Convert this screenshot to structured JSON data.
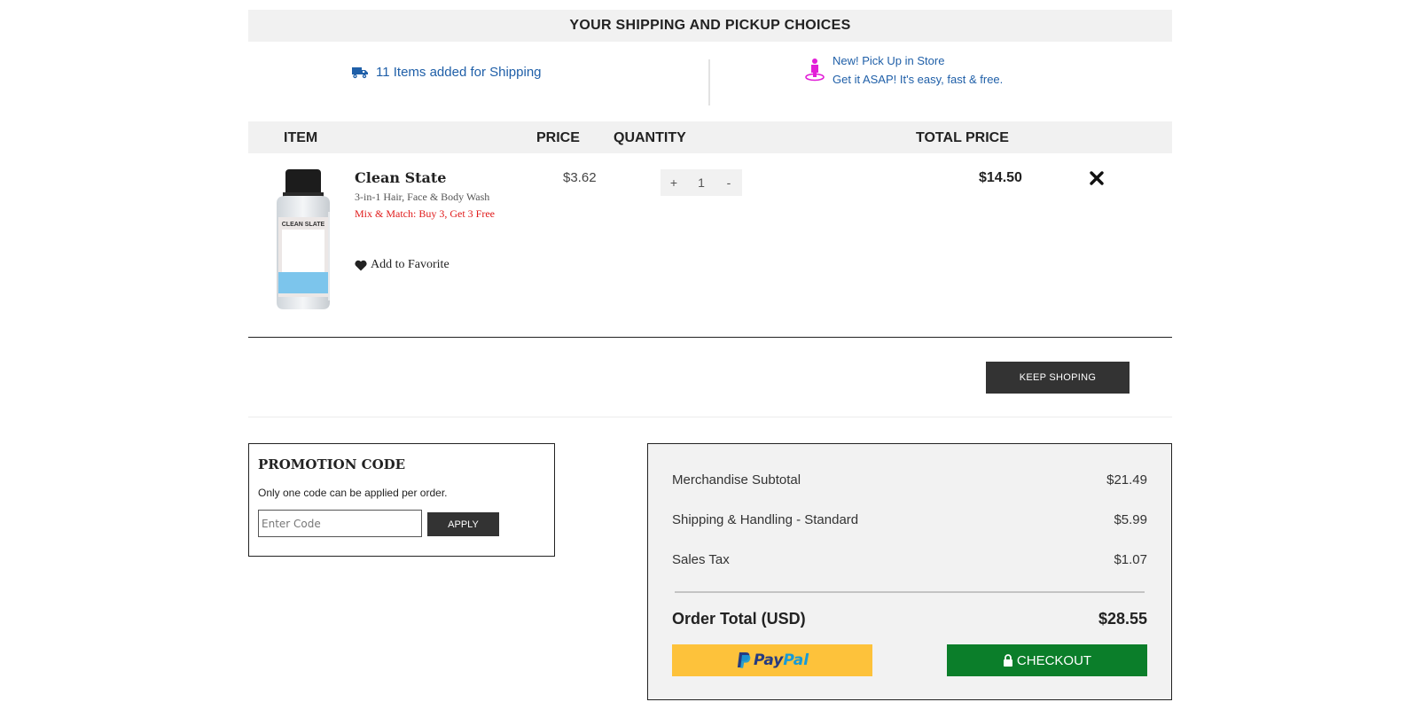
{
  "banner": {
    "title": "YOUR SHIPPING AND PICKUP CHOICES"
  },
  "choices": {
    "shipping_label": "11 Items added for Shipping",
    "pickup_line1": "New! Pick Up in Store",
    "pickup_line2": "Get it ASAP! It's easy, fast & free."
  },
  "table": {
    "headers": {
      "item": "ITEM",
      "price": "PRICE",
      "quantity": "QUANTITY",
      "total": "TOTAL PRICE"
    }
  },
  "item": {
    "image_label": "CLEAN SLATE",
    "name": "Clean State",
    "subtitle": "3-in-1 Hair, Face & Body Wash",
    "promo": "Mix & Match: Buy 3, Get 3 Free",
    "favorite_label": "Add to Favorite",
    "price": "$3.62",
    "qty_plus": "+",
    "qty_value": "1",
    "qty_minus": "-",
    "line_total": "$14.50"
  },
  "keep_shopping": "KEEP SHOPING",
  "promo": {
    "title": "PROMOTION CODE",
    "note": "Only one code can be applied per order.",
    "placeholder": "Enter Code",
    "apply_label": "APPLY"
  },
  "summary": {
    "rows": [
      {
        "label": "Merchandise Subtotal",
        "value": "$21.49"
      },
      {
        "label": "Shipping & Handling - Standard",
        "value": "$5.99"
      },
      {
        "label": "Sales Tax",
        "value": "$1.07"
      }
    ],
    "total_label": "Order Total (USD)",
    "total_value": "$28.55",
    "paypal_pay": "Pay",
    "paypal_pal": "Pal",
    "checkout_label": "CHECKOUT"
  },
  "colors": {
    "link_blue": "#1f5fa8",
    "pickup_magenta": "#e21ed7",
    "promo_red": "#e01a1a",
    "paypal_yellow": "#fdc23b",
    "checkout_green": "#0b7e2a",
    "dark_button": "#333333"
  },
  "icons": [
    "truck-icon",
    "store-pickup-icon",
    "heart-icon",
    "close-icon",
    "lock-icon",
    "paypal-logo"
  ]
}
